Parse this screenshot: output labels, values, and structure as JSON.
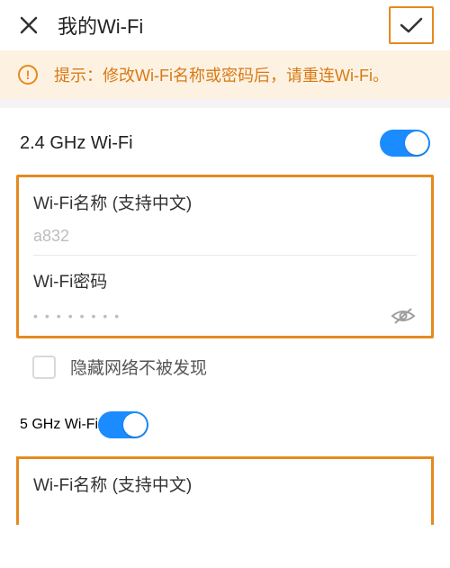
{
  "header": {
    "title": "我的Wi-Fi"
  },
  "tip": {
    "text": "提示：修改Wi-Fi名称或密码后，请重连Wi-Fi。"
  },
  "wifi24": {
    "title": "2.4 GHz Wi-Fi",
    "name_label": "Wi-Fi名称 (支持中文)",
    "name_value": "a832",
    "password_label": "Wi-Fi密码",
    "password_masked": "••••••••",
    "hide_ssid_label": "隐藏网络不被发现",
    "enabled": true,
    "hide_ssid_checked": false
  },
  "wifi5": {
    "title": "5 GHz Wi-Fi",
    "name_label": "Wi-Fi名称 (支持中文)",
    "enabled": true
  },
  "colors": {
    "accent_orange": "#e58a1f",
    "toggle_blue": "#1a8cff",
    "tip_bg": "#fdf2e2"
  }
}
